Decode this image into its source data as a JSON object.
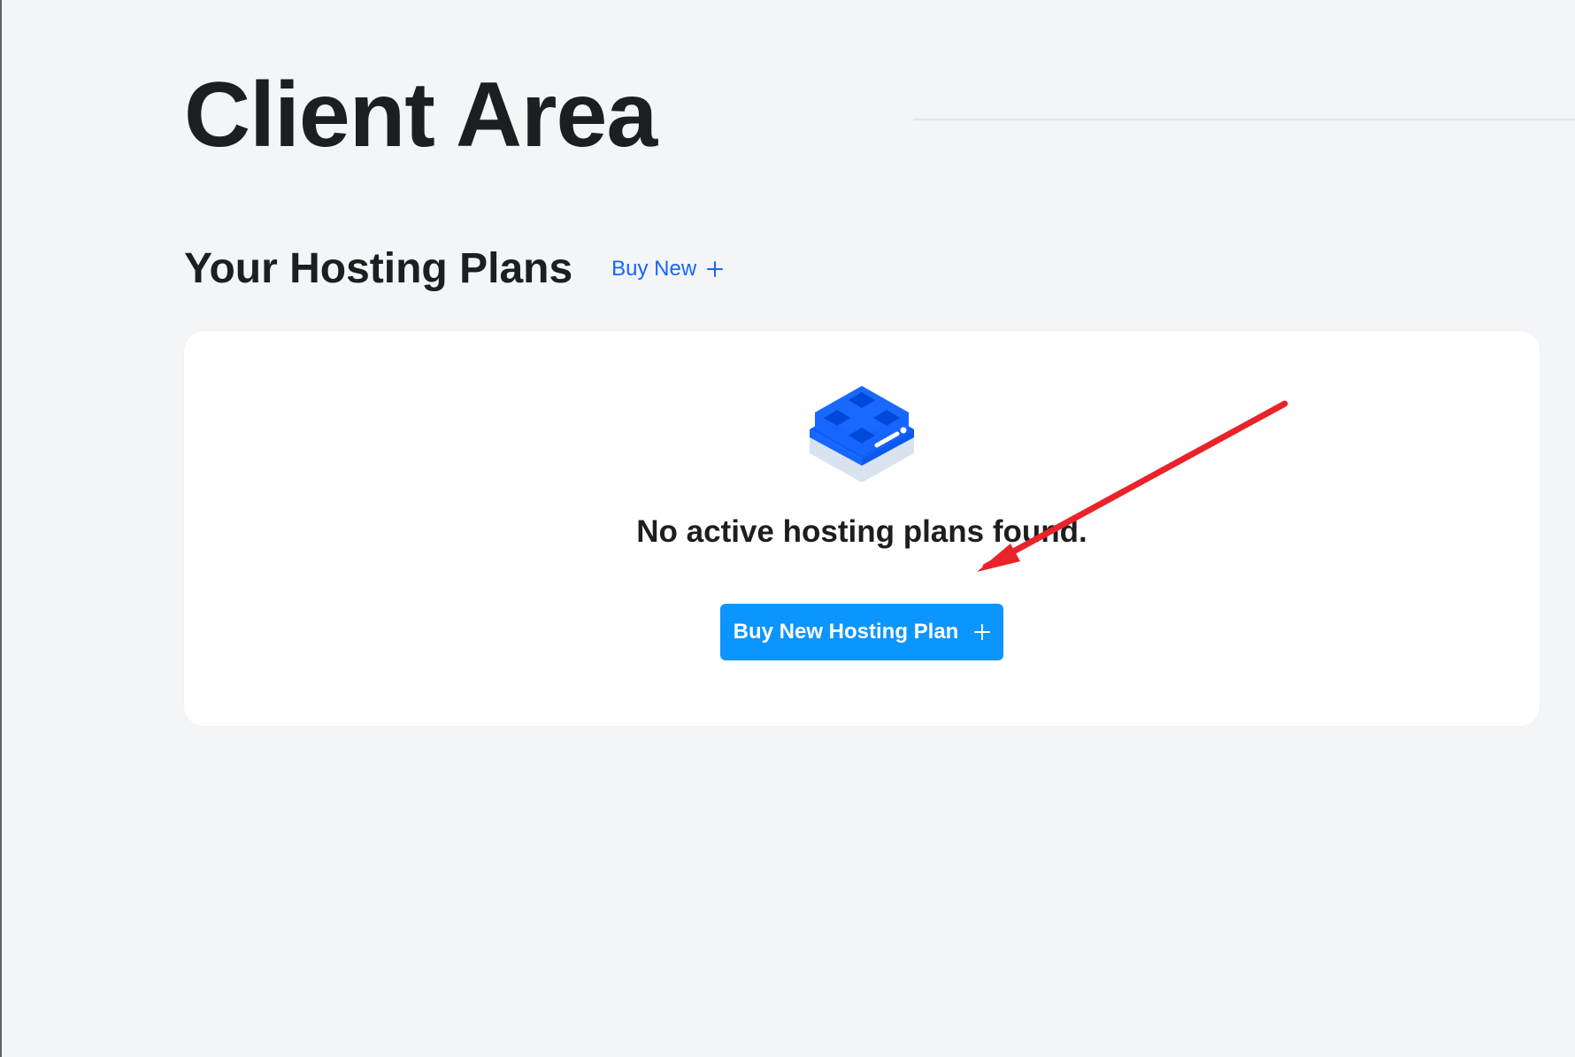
{
  "page": {
    "title": "Client Area"
  },
  "section": {
    "title": "Your Hosting Plans",
    "buy_new_label": "Buy New",
    "buy_new_icon": "plus-icon"
  },
  "empty_state": {
    "icon": "server-icon",
    "message": "No active hosting plans found.",
    "button_label": "Buy New Hosting Plan",
    "button_icon": "plus-icon"
  },
  "colors": {
    "background": "#f4f5f7",
    "text": "#1d1e20",
    "link": "#1565ff",
    "button": "#0b95ff",
    "annotation": "#e9232a"
  }
}
